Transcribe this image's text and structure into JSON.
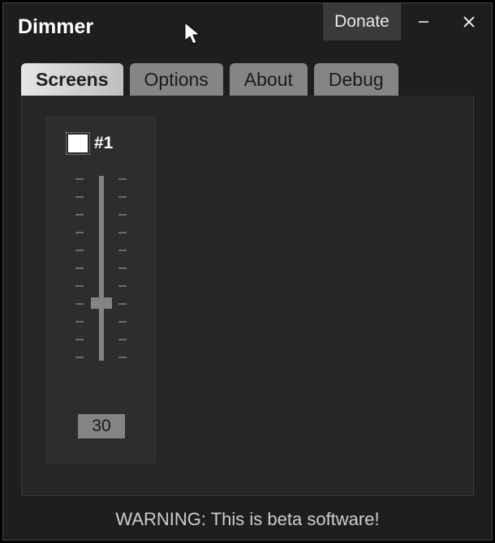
{
  "window": {
    "title": "Dimmer",
    "donate_label": "Donate"
  },
  "tabs": [
    {
      "label": "Screens",
      "active": true
    },
    {
      "label": "Options",
      "active": false
    },
    {
      "label": "About",
      "active": false
    },
    {
      "label": "Debug",
      "active": false
    }
  ],
  "screen_control": {
    "checkbox_checked": true,
    "label": "#1",
    "slider_value": 30,
    "slider_min": 0,
    "slider_max": 100,
    "value_display": "30"
  },
  "footer": {
    "warning": "WARNING: This is beta software!"
  }
}
